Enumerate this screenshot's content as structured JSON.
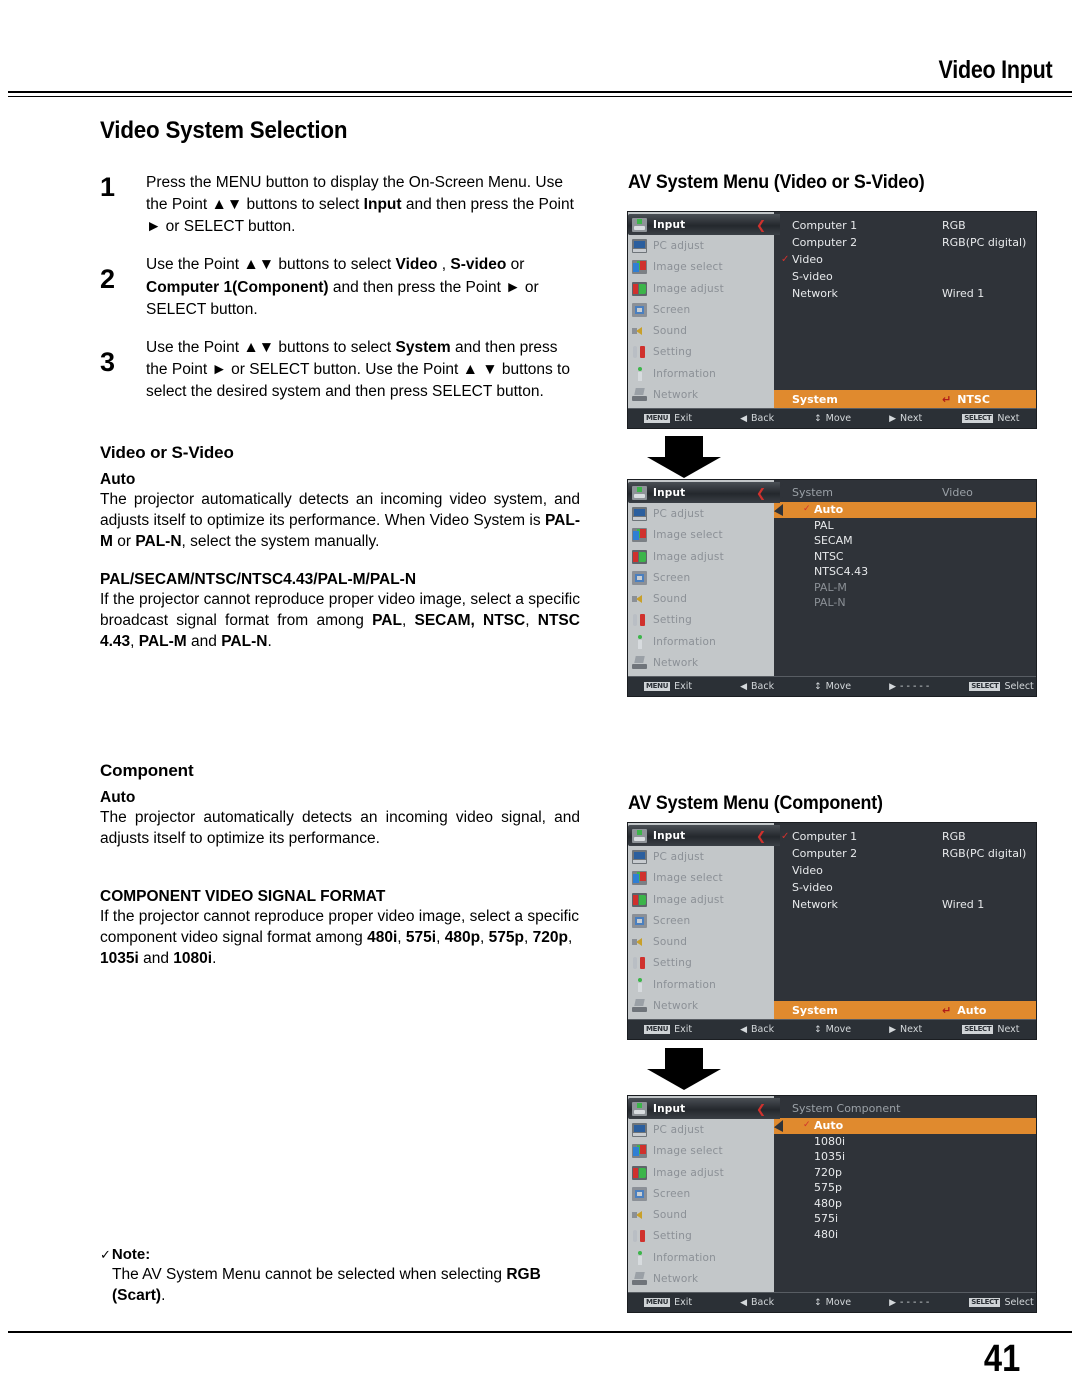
{
  "header": {
    "title": "Video Input"
  },
  "footer": {
    "page_number": "41"
  },
  "section": {
    "title": "Video System Selection"
  },
  "steps": [
    {
      "num": "1",
      "html": "Press the MENU button to display the On-Screen Menu.  Use the Point ▲▼ buttons to select <b>Input</b> and then press the Point ► or SELECT button."
    },
    {
      "num": "2",
      "html": "Use the Point ▲▼ buttons to select <b>Video</b> , <b>S-video</b> or <b>Computer 1(Component)</b> and then press the Point ► or SELECT button."
    },
    {
      "num": "3",
      "html": "Use the Point ▲▼ buttons to select <b>System</b> and then press the Point ► or SELECT button. Use the Point ▲ ▼ buttons to select the desired system and then press SELECT button."
    }
  ],
  "video_section": {
    "heading": "Video or S-Video",
    "auto_label": "Auto",
    "auto_text": "The projector automatically detects an incoming video system, and adjusts itself to optimize its performance. When Video System is <b>PAL-M</b> or <b>PAL-N</b>, select the system manually.",
    "formats_label": "PAL/SECAM/NTSC/NTSC4.43/PAL-M/PAL-N",
    "formats_text": "If the projector cannot reproduce proper video image, select a specific broadcast signal format from among <b>PAL</b>, <b>SECAM, NTSC</b>, <b>NTSC 4.43</b>, <b>PAL-M</b> and <b>PAL-N</b>."
  },
  "component_section": {
    "heading": "Component",
    "auto_label": "Auto",
    "auto_text": "The projector automatically detects an incoming video signal, and adjusts itself to optimize its performance.",
    "formats_label": "COMPONENT VIDEO SIGNAL FORMAT",
    "formats_text": "If the projector cannot reproduce proper video image, select a specific component video signal format among <b>480i</b>, <b>575i</b>, <b>480p</b>, <b>575p</b>, <b>720p</b>, <b>1035i</b> and <b>1080i</b>."
  },
  "note": {
    "check": "✓",
    "label": "Note:",
    "text": "The AV System Menu cannot be selected when selecting <b>RGB (Scart)</b>."
  },
  "figures": {
    "fig1_heading": "AV System Menu (Video or S-Video)",
    "fig2_heading": "AV System Menu (Component)"
  },
  "osd": {
    "sidebar": [
      {
        "label": "Input",
        "icon": "input-icon",
        "active": true
      },
      {
        "label": "PC adjust",
        "icon": "pc-adjust-icon",
        "active": false
      },
      {
        "label": "Image select",
        "icon": "image-select-icon",
        "active": false
      },
      {
        "label": "Image adjust",
        "icon": "image-adjust-icon",
        "active": false
      },
      {
        "label": "Screen",
        "icon": "screen-icon",
        "active": false
      },
      {
        "label": "Sound",
        "icon": "sound-icon",
        "active": false
      },
      {
        "label": "Setting",
        "icon": "setting-icon",
        "active": false
      },
      {
        "label": "Information",
        "icon": "information-icon",
        "active": false
      },
      {
        "label": "Network",
        "icon": "network-icon",
        "active": false
      }
    ],
    "sidebar_arrow": "❮",
    "status_bar": {
      "exit_key": "MENU",
      "exit_label": "Exit",
      "back_glyph": "◀",
      "back_label": "Back",
      "move_glyph": "↕",
      "move_label": "Move",
      "next_glyph": "▶",
      "next_label": "Next",
      "dash_label": "- - - - -",
      "select_key": "SELECT",
      "select_label_next": "Next",
      "select_label_select": "Select"
    },
    "menu1": {
      "rows": [
        {
          "label": "Computer 1",
          "value": "RGB",
          "checked": false
        },
        {
          "label": "Computer 2",
          "value": "RGB(PC digital)",
          "checked": false
        },
        {
          "label": "Video",
          "value": "",
          "checked": true
        },
        {
          "label": "S-video",
          "value": "",
          "checked": false
        },
        {
          "label": "Network",
          "value": "Wired 1",
          "checked": false
        }
      ],
      "system_bar_label": "System",
      "system_bar_value": "NTSC",
      "return_glyph": "↵"
    },
    "menu2": {
      "head_left": "System",
      "head_right": "Video",
      "items": [
        {
          "label": "Auto",
          "selected": true,
          "dimmed": false
        },
        {
          "label": "PAL",
          "selected": false,
          "dimmed": false
        },
        {
          "label": "SECAM",
          "selected": false,
          "dimmed": false
        },
        {
          "label": "NTSC",
          "selected": false,
          "dimmed": false
        },
        {
          "label": "NTSC4.43",
          "selected": false,
          "dimmed": false
        },
        {
          "label": "PAL-M",
          "selected": false,
          "dimmed": true
        },
        {
          "label": "PAL-N",
          "selected": false,
          "dimmed": true
        }
      ],
      "check_glyph": "✓"
    },
    "menu3": {
      "rows": [
        {
          "label": "Computer 1",
          "value": "RGB",
          "checked": true
        },
        {
          "label": "Computer 2",
          "value": "RGB(PC digital)",
          "checked": false
        },
        {
          "label": "Video",
          "value": "",
          "checked": false
        },
        {
          "label": "S-video",
          "value": "",
          "checked": false
        },
        {
          "label": "Network",
          "value": "Wired 1",
          "checked": false
        }
      ],
      "system_bar_label": "System",
      "system_bar_value": "Auto",
      "return_glyph": "↵"
    },
    "menu4": {
      "head_left": "System Component",
      "head_right": "",
      "items": [
        {
          "label": "Auto",
          "selected": true,
          "dimmed": false
        },
        {
          "label": "1080i",
          "selected": false,
          "dimmed": false
        },
        {
          "label": "1035i",
          "selected": false,
          "dimmed": false
        },
        {
          "label": "720p",
          "selected": false,
          "dimmed": false
        },
        {
          "label": "575p",
          "selected": false,
          "dimmed": false
        },
        {
          "label": "480p",
          "selected": false,
          "dimmed": false
        },
        {
          "label": "575i",
          "selected": false,
          "dimmed": false
        },
        {
          "label": "480i",
          "selected": false,
          "dimmed": false
        }
      ],
      "check_glyph": "✓"
    }
  }
}
